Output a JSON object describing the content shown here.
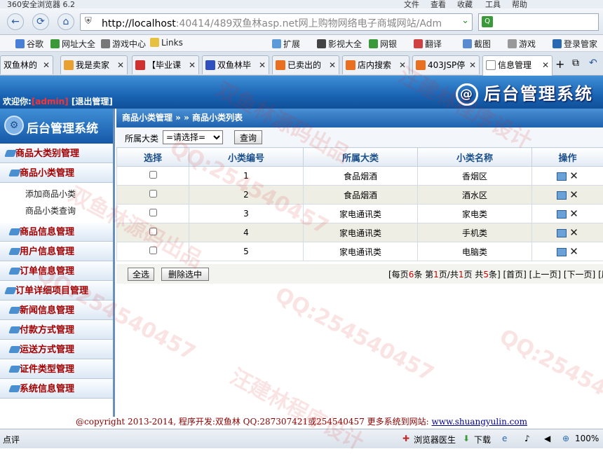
{
  "browser": {
    "title": "360安全浏览器 6.2",
    "menu": [
      "文件",
      "查看",
      "收藏",
      "工具",
      "帮助"
    ],
    "address_host": "http://localhost",
    "address_rest": ":40414/489双鱼林asp.net网上购物网络电子商城网站/Adm",
    "favorites": [
      "谷歌",
      "网址大全",
      "游戏中心",
      "Links",
      "扩展",
      "影视大全",
      "网银",
      "翻译",
      "截图",
      "游戏",
      "登录管家"
    ],
    "tabs": [
      "双鱼林的",
      "我是卖家",
      "【毕业课",
      "双鱼林毕",
      "已卖出的",
      "店内搜索",
      "403JSP停",
      "信息管理"
    ],
    "status_left": "点评",
    "status_items": [
      "浏览器医生",
      "下载",
      "100%"
    ]
  },
  "app": {
    "welcome_label": "欢迎你:",
    "user": "[admin]",
    "logout": "[退出管理]",
    "system_title": "后台管理系统",
    "sidebar_title": "后台管理系统"
  },
  "sidebar": {
    "categories": [
      "商品大类别管理",
      "商品小类管理"
    ],
    "sub_links": [
      "添加商品小类",
      "商品小类查询"
    ],
    "more": [
      "商品信息管理",
      "用户信息管理",
      "订单信息管理",
      "订单详细项目管理",
      "新闻信息管理",
      "付款方式管理",
      "运送方式管理",
      "证件类型管理",
      "系统信息管理"
    ]
  },
  "main": {
    "breadcrumb": "商品小类管理 » » 商品小类列表",
    "filter_label": "所属大类",
    "filter_value": "=请选择=",
    "query_button": "查询",
    "columns": [
      "选择",
      "小类编号",
      "所属大类",
      "小类名称",
      "操作"
    ],
    "rows": [
      {
        "id": "1",
        "parent": "食品烟酒",
        "name": "香烟区"
      },
      {
        "id": "2",
        "parent": "食品烟酒",
        "name": "酒水区"
      },
      {
        "id": "3",
        "parent": "家电通讯类",
        "name": "家电类"
      },
      {
        "id": "4",
        "parent": "家电通讯类",
        "name": "手机类"
      },
      {
        "id": "5",
        "parent": "家电通讯类",
        "name": "电脑类"
      }
    ],
    "select_all": "全选",
    "delete_selected": "删除选中",
    "pager": {
      "per_page_pre": "[每页",
      "per_page": "6",
      "per_page_post": "条 第",
      "page": "1",
      "page_mid": "页/共",
      "total_pages": "1",
      "total_mid": "页 共",
      "total": "5",
      "total_post": "条]",
      "first": "[首页]",
      "prev": "[上一页]",
      "next": "[下一页]",
      "last": "[尾"
    }
  },
  "footer": {
    "text": "@copyright 2013-2014, 程序开发:双鱼林 QQ:287307421或254540457 更多系统到网站:",
    "link": "www.shuangyulin.com"
  },
  "watermarks": [
    "QQ:254540457",
    "汪建林程序设计",
    "双鱼林源码出品"
  ]
}
